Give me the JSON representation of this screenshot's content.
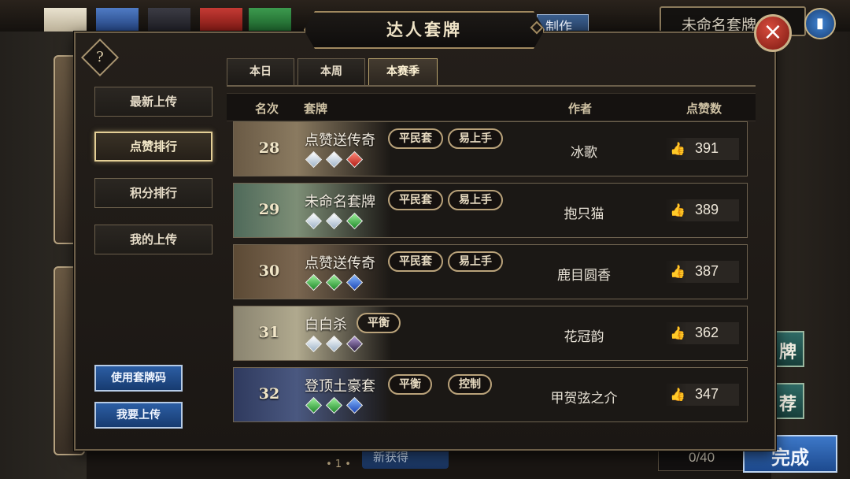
{
  "background": {
    "deck_title": "未命名套牌",
    "make_button": "制作",
    "side_buttons": [
      "牌",
      "荐"
    ],
    "bottom_tab": "新获得",
    "pager": "• 1 •",
    "card_counter": "0/40",
    "finish_button": "完成"
  },
  "modal": {
    "title": "达人套牌",
    "help": "?",
    "close": "×",
    "menu": [
      {
        "label": "最新上传",
        "active": false
      },
      {
        "label": "点赞排行",
        "active": true
      },
      {
        "label": "积分排行",
        "active": false
      },
      {
        "label": "我的上传",
        "active": false
      }
    ],
    "actions": {
      "use_code": "使用套牌码",
      "upload": "我要上传"
    },
    "tabs": [
      {
        "label": "本日",
        "active": false
      },
      {
        "label": "本周",
        "active": false
      },
      {
        "label": "本赛季",
        "active": true
      }
    ],
    "columns": {
      "rank": "名次",
      "deck": "套牌",
      "author": "作者",
      "likes": "点赞数"
    },
    "rows": [
      {
        "rank": "28",
        "name": "点赞送传奇",
        "tags": [
          "平民套",
          "易上手"
        ],
        "gems": [
          "white",
          "white",
          "red"
        ],
        "author": "冰歌",
        "likes": "391"
      },
      {
        "rank": "29",
        "name": "未命名套牌",
        "tags": [
          "平民套",
          "易上手"
        ],
        "gems": [
          "white",
          "white",
          "green"
        ],
        "author": "抱只猫",
        "likes": "389"
      },
      {
        "rank": "30",
        "name": "点赞送传奇",
        "tags": [
          "平民套",
          "易上手"
        ],
        "gems": [
          "green",
          "green",
          "blue"
        ],
        "author": "鹿目圆香",
        "likes": "387"
      },
      {
        "rank": "31",
        "name": "白白杀",
        "tags": [
          "平衡"
        ],
        "gems": [
          "white",
          "white",
          "purple"
        ],
        "author": "花冠韵",
        "likes": "362"
      },
      {
        "rank": "32",
        "name": "登顶土豪套",
        "tags": [
          "平衡",
          "控制"
        ],
        "gems": [
          "green",
          "green",
          "blue"
        ],
        "author": "甲贺弦之介",
        "likes": "347"
      }
    ]
  },
  "colors": {
    "accent_gold": "#e4cf96",
    "button_blue": "#2c5ea4",
    "close_red": "#d64b3c"
  }
}
